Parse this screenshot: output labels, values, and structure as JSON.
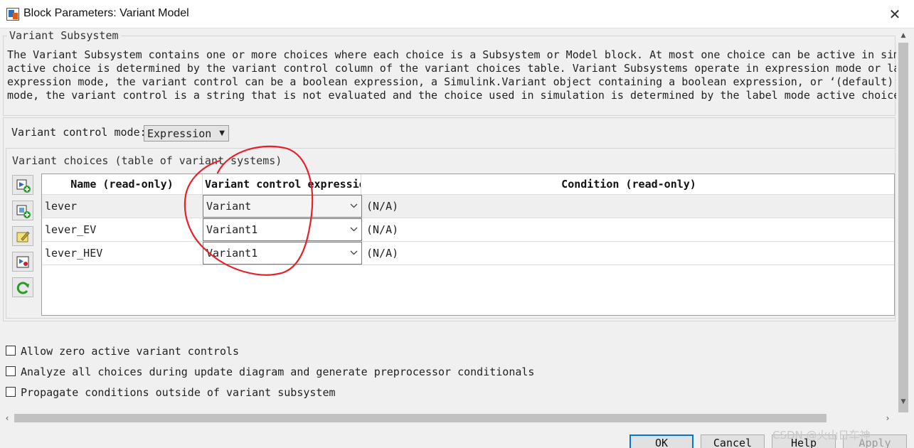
{
  "window": {
    "title": "Block Parameters: Variant Model",
    "close_glyph": "✕"
  },
  "subsystem": {
    "heading": "Variant Subsystem",
    "description": [
      "The Variant Subsystem contains one or more choices where each choice is a Subsystem or Model block. At most one choice can be active in simulation. The",
      "active choice is determined by the variant control column of the variant choices table. Variant Subsystems operate in expression mode or label mode. In",
      "expression mode, the variant control can be a boolean expression, a Simulink.Variant object containing a boolean expression, or  ‘(default)’. In label",
      "mode, the variant control is a string that is not evaluated and the choice used in simulation is determined by the label mode active choice parameter."
    ]
  },
  "control_mode": {
    "label": "Variant control mode:",
    "value": "Expression"
  },
  "choices": {
    "heading": "Variant choices (table of variant systems)",
    "toolbar_icons": [
      "add-subsystem-choice-icon",
      "add-model-choice-icon",
      "edit-choice-icon",
      "open-block-icon",
      "refresh-icon"
    ],
    "columns": [
      "Name (read-only)",
      "Variant control expression",
      "Condition (read-only)"
    ],
    "rows": [
      {
        "name": "lever",
        "control": "Variant",
        "condition": "(N/A)"
      },
      {
        "name": "lever_EV",
        "control": "Variant1",
        "condition": "(N/A)"
      },
      {
        "name": "lever_HEV",
        "control": "Variant1",
        "condition": "(N/A)"
      }
    ]
  },
  "options": [
    {
      "label": "Allow zero active variant controls",
      "checked": false
    },
    {
      "label": "Analyze all choices during update diagram and generate preprocessor conditionals",
      "checked": false
    },
    {
      "label": "Propagate conditions outside of variant subsystem",
      "checked": false
    }
  ],
  "buttons": {
    "ok": "OK",
    "cancel": "Cancel",
    "help": "Help",
    "apply": "Apply"
  },
  "watermark": "CSDN @火山日车神",
  "colors": {
    "annotation": "#e8202a",
    "default_button_border": "#0078d7"
  }
}
